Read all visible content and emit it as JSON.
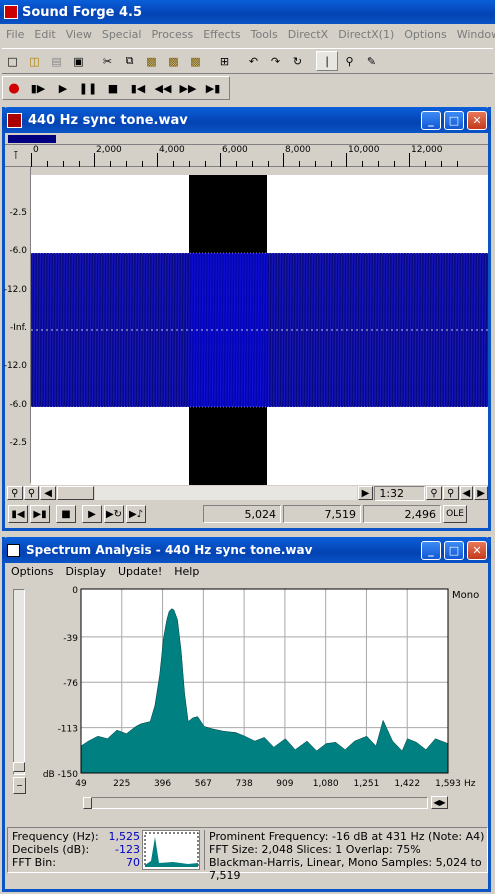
{
  "app": {
    "title": "Sound Forge 4.5"
  },
  "menu": [
    "File",
    "Edit",
    "View",
    "Special",
    "Process",
    "Effects",
    "Tools",
    "DirectX",
    "DirectX(1)",
    "Options",
    "Window",
    "Help"
  ],
  "toolbar": {
    "icons": [
      "new-icon",
      "open-icon",
      "save-as-icon",
      "save-icon",
      "cut-icon",
      "copy-icon",
      "paste-icon",
      "paste-mix-icon",
      "paste-crossfade-icon",
      "crop-icon",
      "undo-icon",
      "redo-icon",
      "repeat-icon",
      "edit-tool-icon",
      "magnify-tool-icon",
      "pencil-tool-icon"
    ]
  },
  "transport": {
    "icons": [
      "record-icon",
      "play-all-icon",
      "play-icon",
      "pause-icon",
      "stop-icon",
      "go-to-start-icon",
      "rewind-icon",
      "forward-icon",
      "go-to-end-icon"
    ]
  },
  "wave_window": {
    "title": "440 Hz sync tone.wav",
    "ruler": [
      "0",
      "2,000",
      "4,000",
      "6,000",
      "8,000",
      "10,000",
      "12,000"
    ],
    "db_labels": [
      "-2.5",
      "-6.0",
      "-12.0",
      "-Inf.",
      "-12.0",
      "-6.0",
      "-2.5"
    ],
    "zoom": "1:32",
    "sel_start": "5,024",
    "sel_end": "7,519",
    "sel_length": "2,496",
    "ole": "OLE"
  },
  "spectrum_window": {
    "title": "Spectrum Analysis - 440 Hz sync tone.wav",
    "menu": [
      "Options",
      "Display",
      "Update!",
      "Help"
    ],
    "mono": "Mono",
    "y_labels": [
      "0",
      "-39",
      "-76",
      "-113",
      "dB -150"
    ],
    "x_labels": [
      "49",
      "225",
      "396",
      "567",
      "738",
      "909",
      "1,080",
      "1,251",
      "1,422",
      "1,593"
    ],
    "x_unit": "Hz",
    "frequency_label": "Frequency (Hz):",
    "frequency_value": "1,525",
    "decibels_label": "Decibels (dB):",
    "decibels_value": "-123",
    "fft_bin_label": "FFT Bin:",
    "fft_bin_value": "70",
    "info_line1": "Prominent Frequency: -16 dB at 431 Hz (Note: A4)",
    "info_line2": "FFT Size: 2,048  Slices: 1  Overlap: 75%",
    "info_line3": "Blackman-Harris, Linear, Mono  Samples: 5,024 to 7,519"
  },
  "colors": {
    "titlebar": "#0a54c6",
    "waveform": "#000080",
    "spectrum_fill": "#008080",
    "selection": "#000000"
  },
  "chart_data": {
    "type": "area",
    "xlabel": "Hz",
    "ylabel": "dB",
    "xlim": [
      49,
      1593
    ],
    "ylim": [
      -150,
      0
    ],
    "x": [
      49,
      80,
      120,
      160,
      200,
      240,
      280,
      300,
      320,
      340,
      360,
      380,
      396,
      410,
      420,
      431,
      440,
      455,
      470,
      485,
      500,
      520,
      540,
      567,
      600,
      650,
      700,
      738,
      780,
      820,
      860,
      909,
      950,
      1000,
      1040,
      1080,
      1120,
      1160,
      1200,
      1251,
      1290,
      1320,
      1360,
      1400,
      1422,
      1460,
      1500,
      1540,
      1593
    ],
    "values": [
      -128,
      -124,
      -120,
      -122,
      -115,
      -118,
      -112,
      -110,
      -109,
      -108,
      -95,
      -70,
      -40,
      -25,
      -18,
      -16,
      -17,
      -25,
      -50,
      -85,
      -108,
      -105,
      -104,
      -112,
      -114,
      -116,
      -117,
      -120,
      -124,
      -121,
      -129,
      -122,
      -131,
      -124,
      -132,
      -126,
      -125,
      -131,
      -124,
      -120,
      -128,
      -107,
      -124,
      -132,
      -122,
      -125,
      -131,
      -122,
      -126
    ]
  }
}
